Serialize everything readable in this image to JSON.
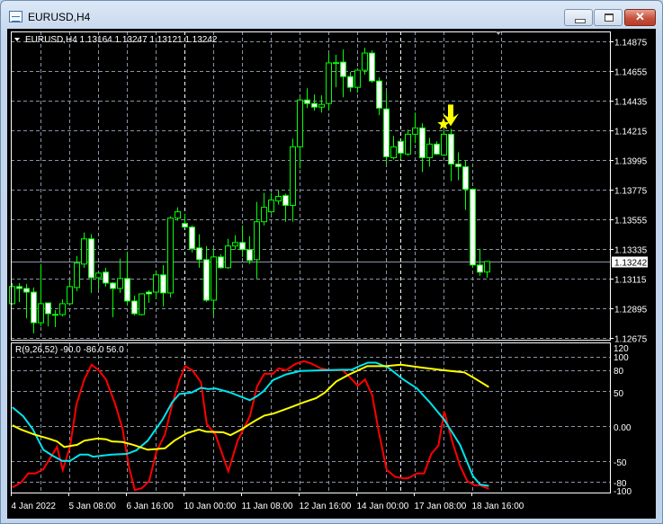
{
  "window": {
    "title": "EURUSD,H4",
    "minimize_icon": "minimize-icon",
    "maximize_icon": "maximize-icon",
    "close_icon": "close-icon"
  },
  "chart": {
    "header": "EURUSD,H4  1.13164 1.13247 1.13121 1.13242",
    "symbol": "EURUSD",
    "timeframe": "H4",
    "ohlc": {
      "open": "1.13164",
      "high": "1.13247",
      "low": "1.13121",
      "close": "1.13242"
    },
    "colors": {
      "background": "#000000",
      "candle_outline": "#00ff00",
      "bull_body": "#000000",
      "bear_body": "#ffffff",
      "grid": "#8a94a6",
      "current_price_line": "#8a94a6",
      "signal": "#ffff00"
    },
    "current_price_label": "1.13242",
    "current_price": 1.13242,
    "price_ticks": [
      "1.14875",
      "1.14655",
      "1.14435",
      "1.14215",
      "1.13995",
      "1.13775",
      "1.13555",
      "1.13335",
      "1.13115",
      "1.12895",
      "1.12675"
    ],
    "price_range": [
      1.12675,
      1.14875
    ],
    "time_labels": [
      {
        "bar": 0,
        "label": "4 Jan 2022"
      },
      {
        "bar": 8,
        "label": "5 Jan 08:00"
      },
      {
        "bar": 16,
        "label": "6 Jan 16:00"
      },
      {
        "bar": 24,
        "label": "10 Jan 00:00"
      },
      {
        "bar": 32,
        "label": "11 Jan 08:00"
      },
      {
        "bar": 40,
        "label": "12 Jan 16:00"
      },
      {
        "bar": 48,
        "label": "14 Jan 00:00"
      },
      {
        "bar": 56,
        "label": "17 Jan 08:00"
      },
      {
        "bar": 64,
        "label": "18 Jan 16:00"
      }
    ],
    "period_separators": [
      24,
      54
    ],
    "signals": [
      {
        "type": "star",
        "icon": "star-icon",
        "bar": 60,
        "price": 1.1426
      },
      {
        "type": "arrow-down",
        "icon": "arrow-down-icon",
        "bar": 61,
        "price": 1.14246
      }
    ],
    "candles_ohlc": [
      [
        1.12929,
        1.13082,
        1.12922,
        1.13056
      ],
      [
        1.13056,
        1.13082,
        1.12942,
        1.13042
      ],
      [
        1.13042,
        1.13076,
        1.12821,
        1.13015
      ],
      [
        1.13015,
        1.13049,
        1.12708,
        1.12788
      ],
      [
        1.12788,
        1.13223,
        1.12761,
        1.12929
      ],
      [
        1.12935,
        1.12935,
        1.12761,
        1.12855
      ],
      [
        1.12848,
        1.12882,
        1.12755,
        1.1285
      ],
      [
        1.12848,
        1.12962,
        1.12835,
        1.12929
      ],
      [
        1.12929,
        1.13102,
        1.12922,
        1.13056
      ],
      [
        1.13049,
        1.13283,
        1.13022,
        1.1323
      ],
      [
        1.13223,
        1.13457,
        1.13196,
        1.1341
      ],
      [
        1.1341,
        1.13444,
        1.13009,
        1.13122
      ],
      [
        1.13122,
        1.13156,
        1.13036,
        1.13156
      ],
      [
        1.13163,
        1.13196,
        1.13056,
        1.13082
      ],
      [
        1.13082,
        1.13089,
        1.12828,
        1.13042
      ],
      [
        1.13042,
        1.13263,
        1.13009,
        1.13116
      ],
      [
        1.13116,
        1.1331,
        1.12915,
        1.12949
      ],
      [
        1.12949,
        1.12989,
        1.12842,
        1.12855
      ],
      [
        1.12848,
        1.13002,
        1.12842,
        1.13002
      ],
      [
        1.13015,
        1.13029,
        1.12935,
        1.13002
      ],
      [
        1.13015,
        1.13176,
        1.12962,
        1.13143
      ],
      [
        1.13143,
        1.13216,
        1.12908,
        1.13009
      ],
      [
        1.13009,
        1.13577,
        1.12975,
        1.13564
      ],
      [
        1.13564,
        1.13644,
        1.13544,
        1.13611
      ],
      [
        1.13524,
        1.13597,
        1.1349,
        1.13497
      ],
      [
        1.13497,
        1.1351,
        1.1331,
        1.13337
      ],
      [
        1.13343,
        1.13444,
        1.13196,
        1.13256
      ],
      [
        1.13256,
        1.13357,
        1.12942,
        1.12955
      ],
      [
        1.12955,
        1.13343,
        1.12842,
        1.13276
      ],
      [
        1.13276,
        1.13296,
        1.13189,
        1.13196
      ],
      [
        1.13196,
        1.1341,
        1.13189,
        1.13357
      ],
      [
        1.13357,
        1.13437,
        1.1333,
        1.13383
      ],
      [
        1.13383,
        1.1351,
        1.13276,
        1.1333
      ],
      [
        1.1333,
        1.1343,
        1.13223,
        1.1325
      ],
      [
        1.13256,
        1.13684,
        1.13116,
        1.13537
      ],
      [
        1.13537,
        1.13751,
        1.1351,
        1.13644
      ],
      [
        1.13611,
        1.13751,
        1.13597,
        1.13698
      ],
      [
        1.13691,
        1.13771,
        1.13664,
        1.13725
      ],
      [
        1.13731,
        1.13745,
        1.13537,
        1.13658
      ],
      [
        1.13658,
        1.14153,
        1.13537,
        1.14093
      ],
      [
        1.14093,
        1.1446,
        1.13932,
        1.1444
      ],
      [
        1.1444,
        1.14527,
        1.1438,
        1.14414
      ],
      [
        1.14414,
        1.14481,
        1.1436,
        1.14387
      ],
      [
        1.14387,
        1.14474,
        1.14347,
        1.14407
      ],
      [
        1.14414,
        1.14788,
        1.14367,
        1.14715
      ],
      [
        1.14715,
        1.14775,
        1.14534,
        1.14717
      ],
      [
        1.14721,
        1.14815,
        1.1446,
        1.14614
      ],
      [
        1.14614,
        1.14648,
        1.14501,
        1.14534
      ],
      [
        1.14534,
        1.14675,
        1.14494,
        1.14661
      ],
      [
        1.14661,
        1.14828,
        1.14628,
        1.14788
      ],
      [
        1.14788,
        1.14808,
        1.14568,
        1.14581
      ],
      [
        1.14581,
        1.14608,
        1.14327,
        1.1438
      ],
      [
        1.14374,
        1.14501,
        1.13965,
        1.14019
      ],
      [
        1.14012,
        1.14173,
        1.13999,
        1.14093
      ],
      [
        1.14133,
        1.14133,
        1.13999,
        1.14046
      ],
      [
        1.14039,
        1.1422,
        1.14026,
        1.14186
      ],
      [
        1.14186,
        1.14347,
        1.14119,
        1.14233
      ],
      [
        1.14233,
        1.14267,
        1.13905,
        1.14012
      ],
      [
        1.14012,
        1.14159,
        1.13945,
        1.14113
      ],
      [
        1.14113,
        1.14133,
        1.14032,
        1.14039
      ],
      [
        1.14032,
        1.1422,
        1.14026,
        1.14186
      ],
      [
        1.14186,
        1.14226,
        1.13838,
        1.13965
      ],
      [
        1.13965,
        1.14052,
        1.13845,
        1.13945
      ],
      [
        1.13945,
        1.13992,
        1.13624,
        1.13778
      ],
      [
        1.13778,
        1.13785,
        1.13196,
        1.13216
      ],
      [
        1.13216,
        1.13337,
        1.13136,
        1.13163
      ],
      [
        1.13164,
        1.13247,
        1.13121,
        1.13242
      ]
    ]
  },
  "indicator": {
    "label": "R(9,26,52) -90.0 -86.0 56.0",
    "name": "R",
    "params": "9,26,52",
    "current_values": [
      "-90.0",
      "-86.0",
      "56.0"
    ],
    "ticks": [
      "120",
      "100",
      "80",
      "50",
      "0.00",
      "-50",
      "-80",
      "-100"
    ],
    "tick_values": [
      120,
      100,
      80,
      50,
      0,
      -50,
      -80,
      -100
    ],
    "grid_levels": [
      100,
      80,
      50,
      0,
      -50,
      -80
    ],
    "range": [
      -100,
      120
    ],
    "series": [
      {
        "color": "#ff0000",
        "points": [
          [
            0.1,
            -88
          ],
          [
            1.3,
            -81
          ],
          [
            2.3,
            -68
          ],
          [
            3.3,
            -68
          ],
          [
            4.4,
            -62
          ],
          [
            5.1,
            -50
          ],
          [
            6.3,
            -30
          ],
          [
            7.1,
            -63
          ],
          [
            8.1,
            -30
          ],
          [
            9,
            31
          ],
          [
            10.1,
            67
          ],
          [
            11.1,
            88
          ],
          [
            12.1,
            80
          ],
          [
            13.1,
            67
          ],
          [
            14.4,
            31
          ],
          [
            15.4,
            -4
          ],
          [
            16.3,
            -59
          ],
          [
            17.1,
            -92
          ],
          [
            18.1,
            -89
          ],
          [
            19.1,
            -79
          ],
          [
            20.1,
            -37
          ],
          [
            21.3,
            -12
          ],
          [
            22.3,
            31
          ],
          [
            23.3,
            66
          ],
          [
            24.1,
            86
          ],
          [
            25.1,
            80
          ],
          [
            26.3,
            63
          ],
          [
            27.1,
            3
          ],
          [
            28.3,
            -12
          ],
          [
            30.1,
            -65
          ],
          [
            31.4,
            -21
          ],
          [
            33.1,
            14
          ],
          [
            34.1,
            57
          ],
          [
            35.1,
            75
          ],
          [
            36.3,
            75
          ],
          [
            37.1,
            83
          ],
          [
            38.1,
            80
          ],
          [
            39.4,
            89
          ],
          [
            40.6,
            93
          ],
          [
            41.6,
            90
          ],
          [
            42.9,
            83
          ],
          [
            44.4,
            80
          ],
          [
            46,
            80
          ],
          [
            47,
            70
          ],
          [
            48.1,
            58
          ],
          [
            49.1,
            67
          ],
          [
            50.1,
            44
          ],
          [
            51,
            -8
          ],
          [
            52.1,
            -63
          ],
          [
            53.3,
            -73
          ],
          [
            54.4,
            -75
          ],
          [
            55.1,
            -75
          ],
          [
            56.3,
            -68
          ],
          [
            57.3,
            -68
          ],
          [
            58.3,
            -40
          ],
          [
            59.3,
            -28
          ],
          [
            60.1,
            21
          ],
          [
            61.3,
            -25
          ],
          [
            62.3,
            -57
          ],
          [
            63.3,
            -79
          ],
          [
            64.3,
            -85
          ],
          [
            65.1,
            -85
          ],
          [
            66.3,
            -90
          ]
        ]
      },
      {
        "color": "#00e5ee",
        "points": [
          [
            0.1,
            27
          ],
          [
            1.6,
            14
          ],
          [
            2.9,
            -4
          ],
          [
            4.4,
            -34
          ],
          [
            5.6,
            -42
          ],
          [
            7,
            -50
          ],
          [
            8.1,
            -50
          ],
          [
            9.5,
            -41
          ],
          [
            10.6,
            -41
          ],
          [
            11.3,
            -44
          ],
          [
            13.9,
            -41
          ],
          [
            16,
            -40
          ],
          [
            17.3,
            -35
          ],
          [
            18.9,
            -21
          ],
          [
            21,
            10
          ],
          [
            22.3,
            34
          ],
          [
            23.3,
            46
          ],
          [
            25,
            48
          ],
          [
            26.3,
            55
          ],
          [
            27.3,
            53
          ],
          [
            28.3,
            54
          ],
          [
            30.4,
            48
          ],
          [
            33.1,
            37
          ],
          [
            34.1,
            43
          ],
          [
            35,
            50
          ],
          [
            36.3,
            66
          ],
          [
            38.1,
            74
          ],
          [
            40.1,
            79
          ],
          [
            43.1,
            80
          ],
          [
            47.3,
            81
          ],
          [
            48.3,
            86
          ],
          [
            49.5,
            91
          ],
          [
            50.6,
            91
          ],
          [
            52.3,
            84
          ],
          [
            54.4,
            67
          ],
          [
            56.3,
            54
          ],
          [
            58.1,
            34
          ],
          [
            60.1,
            9
          ],
          [
            62.3,
            -27
          ],
          [
            64.1,
            -72
          ],
          [
            65.1,
            -84
          ],
          [
            66.3,
            -86
          ]
        ]
      },
      {
        "color": "#ffff00",
        "points": [
          [
            0.1,
            1
          ],
          [
            1.3,
            -5
          ],
          [
            3.1,
            -12
          ],
          [
            5.1,
            -18
          ],
          [
            6.3,
            -22
          ],
          [
            7.3,
            -30
          ],
          [
            9.1,
            -27
          ],
          [
            10.1,
            -21
          ],
          [
            11.9,
            -18
          ],
          [
            13.1,
            -19
          ],
          [
            13.9,
            -22
          ],
          [
            15.4,
            -23
          ],
          [
            16.9,
            -27
          ],
          [
            18.9,
            -34
          ],
          [
            21.3,
            -32
          ],
          [
            22.6,
            -21
          ],
          [
            24.4,
            -10
          ],
          [
            26,
            -5
          ],
          [
            27,
            -8
          ],
          [
            29.4,
            -9
          ],
          [
            30.4,
            -13
          ],
          [
            31.9,
            -5
          ],
          [
            33.1,
            3
          ],
          [
            33.9,
            8
          ],
          [
            35.1,
            15
          ],
          [
            36.4,
            18
          ],
          [
            38.5,
            26
          ],
          [
            40.6,
            34
          ],
          [
            42.3,
            40
          ],
          [
            43.5,
            48
          ],
          [
            45.1,
            64
          ],
          [
            46.9,
            74
          ],
          [
            49.4,
            86
          ],
          [
            51.9,
            86
          ],
          [
            54.1,
            88
          ],
          [
            56.9,
            84
          ],
          [
            60.1,
            80
          ],
          [
            62.9,
            77
          ],
          [
            64.1,
            70
          ],
          [
            66.3,
            56
          ]
        ]
      }
    ]
  }
}
